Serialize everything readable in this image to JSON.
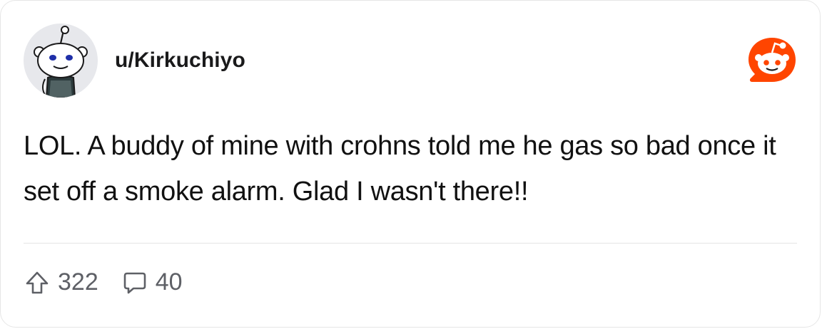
{
  "post": {
    "username": "u/Kirkuchiyo",
    "body": "LOL. A buddy of mine with crohns told me he gas so bad once it set off a smoke alarm. Glad I wasn't there!!",
    "upvotes": "322",
    "comments": "40"
  },
  "icons": {
    "avatar": "snoo-avatar",
    "logo": "reddit-logo-icon",
    "upvote": "upvote-arrow-icon",
    "comment": "comment-bubble-icon"
  },
  "colors": {
    "brand": "#ff4500",
    "text": "#111111",
    "muted": "#5e6066",
    "border": "#e6e6e6"
  }
}
